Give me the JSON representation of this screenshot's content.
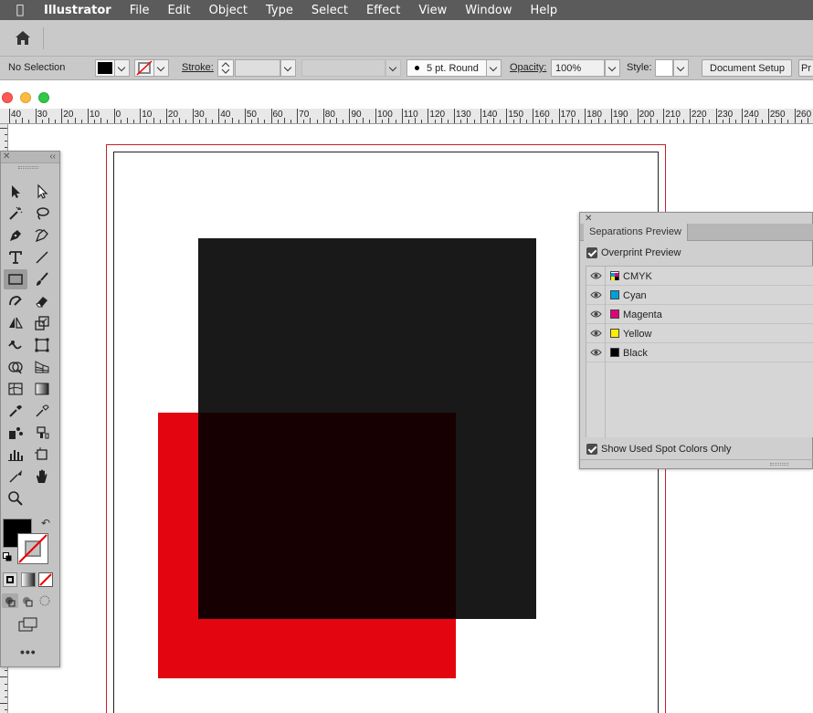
{
  "menubar": {
    "app_name": "Illustrator",
    "items": [
      "File",
      "Edit",
      "Object",
      "Type",
      "Select",
      "Effect",
      "View",
      "Window",
      "Help"
    ]
  },
  "control_bar": {
    "selection_status": "No Selection",
    "stroke_label": "Stroke:",
    "brush_value": "5 pt. Round",
    "opacity_label": "Opacity:",
    "opacity_value": "100%",
    "style_label": "Style:",
    "document_setup_label": "Document Setup",
    "preferences_label": "Pr"
  },
  "ruler": {
    "labels": [
      "40",
      "30",
      "20",
      "10",
      "0",
      "10",
      "20",
      "30",
      "40",
      "50",
      "60",
      "70",
      "80",
      "90",
      "100",
      "110",
      "120",
      "130",
      "140",
      "150",
      "160",
      "170",
      "180",
      "190",
      "200",
      "210",
      "220",
      "230",
      "240",
      "250",
      "260"
    ]
  },
  "separations_panel": {
    "title": "Separations Preview",
    "overprint_preview": {
      "label": "Overprint Preview",
      "checked": true
    },
    "separations": [
      {
        "name": "CMYK",
        "color": "cmyk"
      },
      {
        "name": "Cyan",
        "color": "#00a0d6"
      },
      {
        "name": "Magenta",
        "color": "#e2007a"
      },
      {
        "name": "Yellow",
        "color": "#ffed00"
      },
      {
        "name": "Black",
        "color": "#000000"
      }
    ],
    "show_used_spot_colors": {
      "label": "Show Used Spot Colors Only",
      "checked": true
    }
  },
  "colors": {
    "menubar_bg": "#5b5b5b",
    "ui_gray": "#c9c9c9",
    "bleed_line": "#c61f27",
    "red_shape": "#e3050f",
    "black_shape": "#1a1a1a",
    "overlap": "#1f0000"
  },
  "tools": [
    "selection-tool",
    "direct-selection-tool",
    "magic-wand-tool",
    "lasso-tool",
    "pen-tool",
    "curvature-tool",
    "type-tool",
    "line-segment-tool",
    "rectangle-tool",
    "paintbrush-tool",
    "shaper-tool",
    "eraser-tool",
    "reflect-tool",
    "scale-tool",
    "warp-tool",
    "free-transform-tool",
    "shape-builder-tool",
    "perspective-grid-tool",
    "mesh-tool",
    "gradient-tool",
    "eyedropper-tool",
    "blend-tool",
    "symbol-sprayer-tool",
    "live-paint-tool",
    "column-graph-tool",
    "artboard-tool",
    "slice-tool",
    "hand-tool",
    "zoom-tool"
  ]
}
